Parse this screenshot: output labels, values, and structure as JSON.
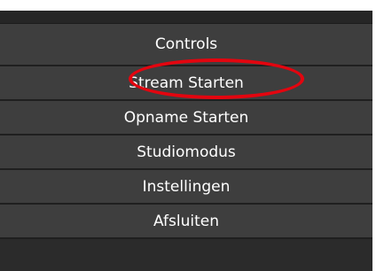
{
  "panel": {
    "title": "Controls"
  },
  "buttons": [
    {
      "label": "Stream Starten"
    },
    {
      "label": "Opname Starten"
    },
    {
      "label": "Studiomodus"
    },
    {
      "label": "Instellingen"
    },
    {
      "label": "Afsluiten"
    }
  ],
  "annotation": {
    "highlight_color": "#e3050f",
    "highlighted_item": "Stream Starten"
  }
}
